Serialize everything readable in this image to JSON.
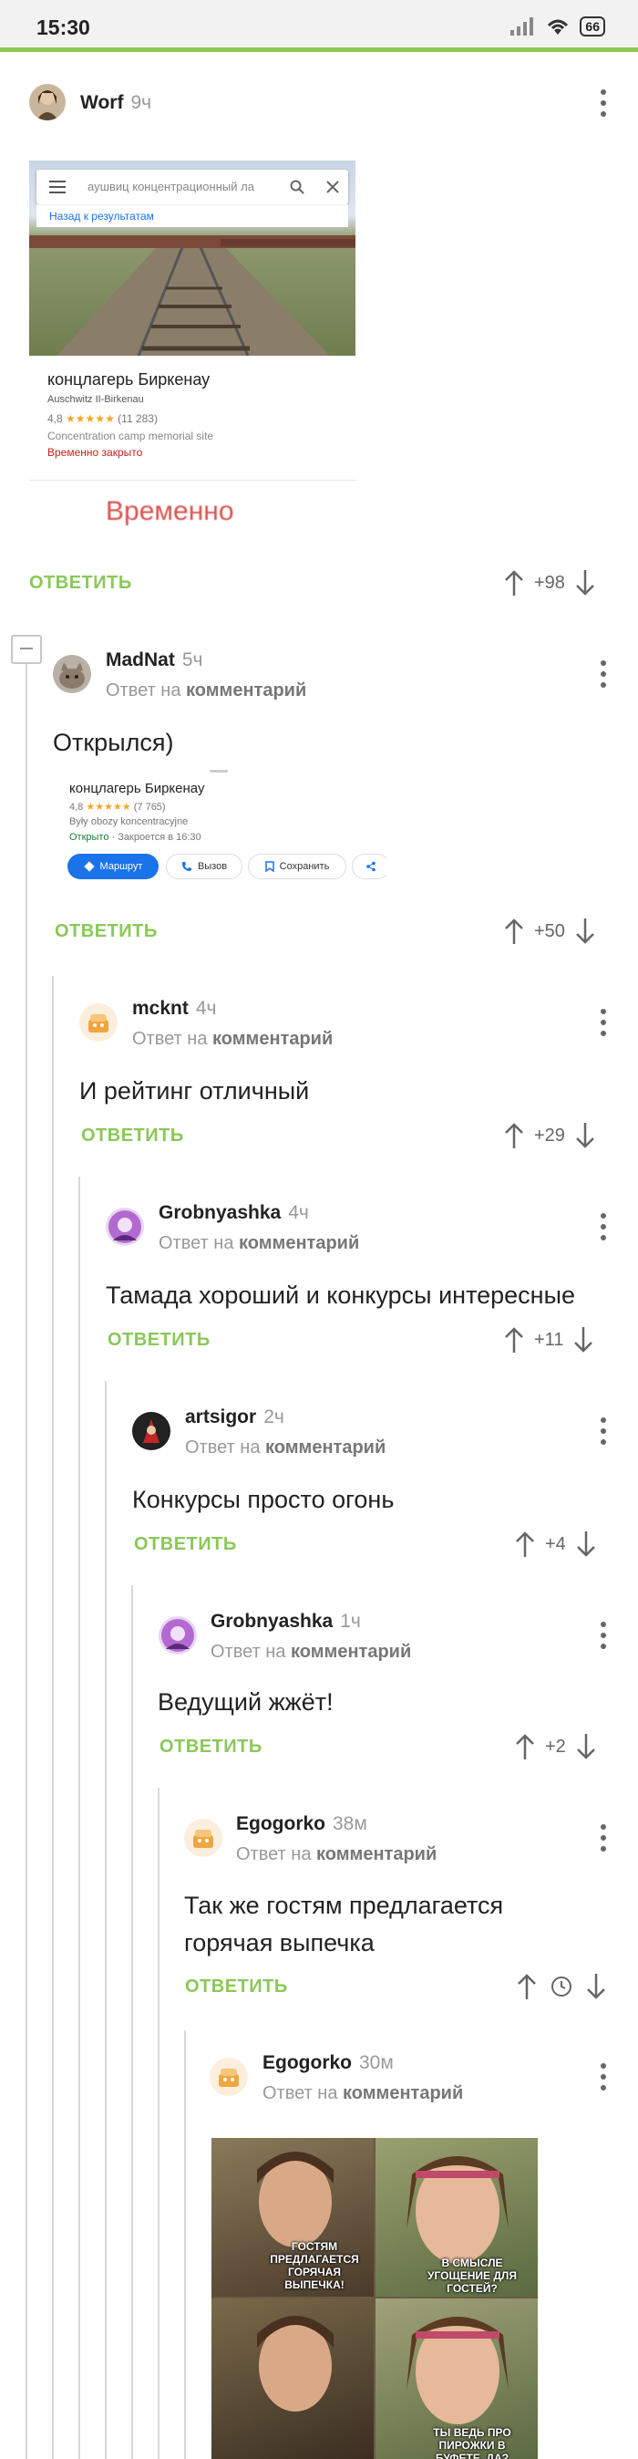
{
  "status": {
    "time": "15:30",
    "battery": "66"
  },
  "labels": {
    "reply": "ОТВЕТИТЬ",
    "reply_to_prefix": "Ответ на",
    "reply_to_target": "комментарий"
  },
  "post": {
    "author": "Worf",
    "time": "9ч",
    "map_card": {
      "search_text": "аушвиц концентрационный ла",
      "back_link": "Назад к результатам",
      "place_name": "концлагерь Биркенау",
      "subtitle": "Auschwitz II-Birkenau",
      "rating": "4,8",
      "stars": "★★★★★",
      "reviews": "(11 283)",
      "category": "Concentration camp memorial site",
      "status": "Временно закрыто",
      "big_status": "Временно"
    },
    "score": "+98"
  },
  "comments": [
    {
      "author": "MadNat",
      "time": "5ч",
      "text": "Открылся)",
      "score": "+50",
      "card": {
        "name": "концлагерь Биркенау",
        "rating": "4,8",
        "stars": "★★★★★",
        "reviews": "(7 765)",
        "category": "Były obozy koncentracyjne",
        "open": "Открыто",
        "closes": "· Закроется в 16:30",
        "btn_route": "Маршрут",
        "btn_call": "Вызов",
        "btn_save": "Сохранить"
      }
    },
    {
      "author": "mcknt",
      "time": "4ч",
      "text": "И рейтинг отличный",
      "score": "+29"
    },
    {
      "author": "Grobnyashka",
      "time": "4ч",
      "text": "Тамада хороший и конкурсы интересные",
      "score": "+11"
    },
    {
      "author": "artsigor",
      "time": "2ч",
      "text": "Конкурсы просто огонь",
      "score": "+4"
    },
    {
      "author": "Grobnyashka",
      "time": "1ч",
      "text": "Ведущий жжёт!",
      "score": "+2"
    },
    {
      "author": "Egogorko",
      "time": "38м",
      "text_line1": "Так же гостям предлагается",
      "text_line2": "горячая выпечка"
    },
    {
      "author": "Egogorko",
      "time": "30м",
      "meme": {
        "caption1": "ГОСТЯМ ПРЕДЛАГАЕТСЯ ГОРЯЧАЯ ВЫПЕЧКА!",
        "caption2": "В СМЫСЛЕ УГОЩЕНИЕ ДЛЯ ГОСТЕЙ?",
        "caption3": "ТЫ ВЕДЬ ПРО ПИРОЖКИ В БУФЕТЕ, ДА?"
      }
    }
  ],
  "colors": {
    "accent": "#8ac858",
    "muted": "#999999"
  }
}
